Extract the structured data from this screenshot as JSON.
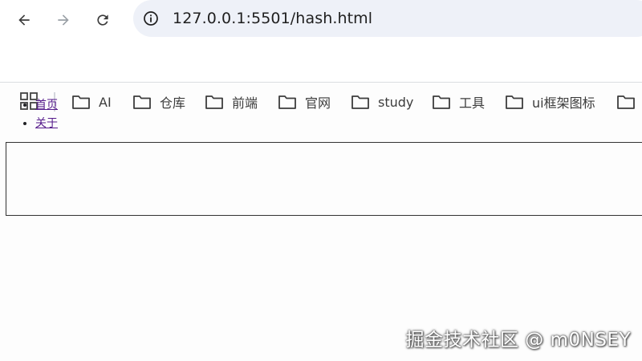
{
  "browser": {
    "url": "127.0.0.1:5501/hash.html",
    "bookmarks": [
      {
        "label": "AI",
        "icon": "folder-icon"
      },
      {
        "label": "仓库",
        "icon": "folder-icon"
      },
      {
        "label": "前端",
        "icon": "folder-icon"
      },
      {
        "label": "官网",
        "icon": "folder-icon"
      },
      {
        "label": "study",
        "icon": "folder-icon"
      },
      {
        "label": "工具",
        "icon": "folder-icon"
      },
      {
        "label": "ui框架图标",
        "icon": "folder-icon"
      },
      {
        "label": "",
        "icon": "folder-icon"
      }
    ]
  },
  "page": {
    "links": [
      {
        "label": "首页"
      },
      {
        "label": "关于"
      }
    ]
  },
  "watermark": "掘金技术社区 @ m0NSEY"
}
